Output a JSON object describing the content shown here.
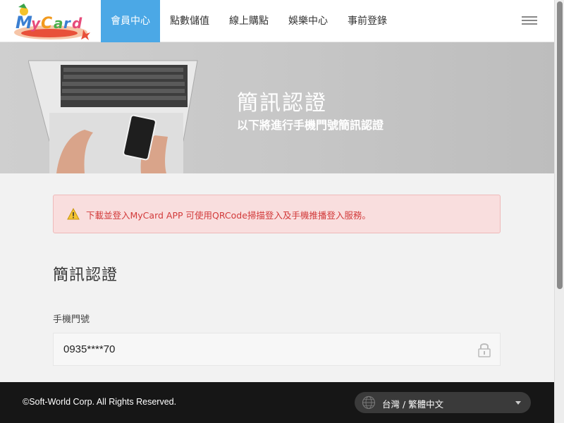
{
  "brand": {
    "logo_text": "MyCard",
    "logo_icon": "mycard-logo"
  },
  "nav": {
    "items": [
      {
        "label": "會員中心",
        "active": true
      },
      {
        "label": "點數儲值",
        "active": false
      },
      {
        "label": "線上購點",
        "active": false
      },
      {
        "label": "娛樂中心",
        "active": false
      },
      {
        "label": "事前登錄",
        "active": false
      }
    ],
    "menu_icon": "hamburger-menu-icon"
  },
  "banner": {
    "title": "簡訊認證",
    "subtitle": "以下將進行手機門號簡訊認證"
  },
  "alert": {
    "icon": "warning-icon",
    "text": "下載並登入MyCard APP 可使用QRCode掃描登入及手機推播登入服務。"
  },
  "form": {
    "section_title": "簡訊認證",
    "phone_label": "手機門號",
    "phone_value": "0935****70",
    "lock_icon": "lock-icon"
  },
  "footer": {
    "copyright": "©Soft-World Corp. All Rights Reserved.",
    "language": "台灣 / 繁體中文",
    "globe_icon": "globe-icon"
  },
  "colors": {
    "nav_active": "#4ba8e6",
    "alert_bg": "#f9dede",
    "alert_text": "#d23a3a",
    "footer_bg": "#161616"
  }
}
